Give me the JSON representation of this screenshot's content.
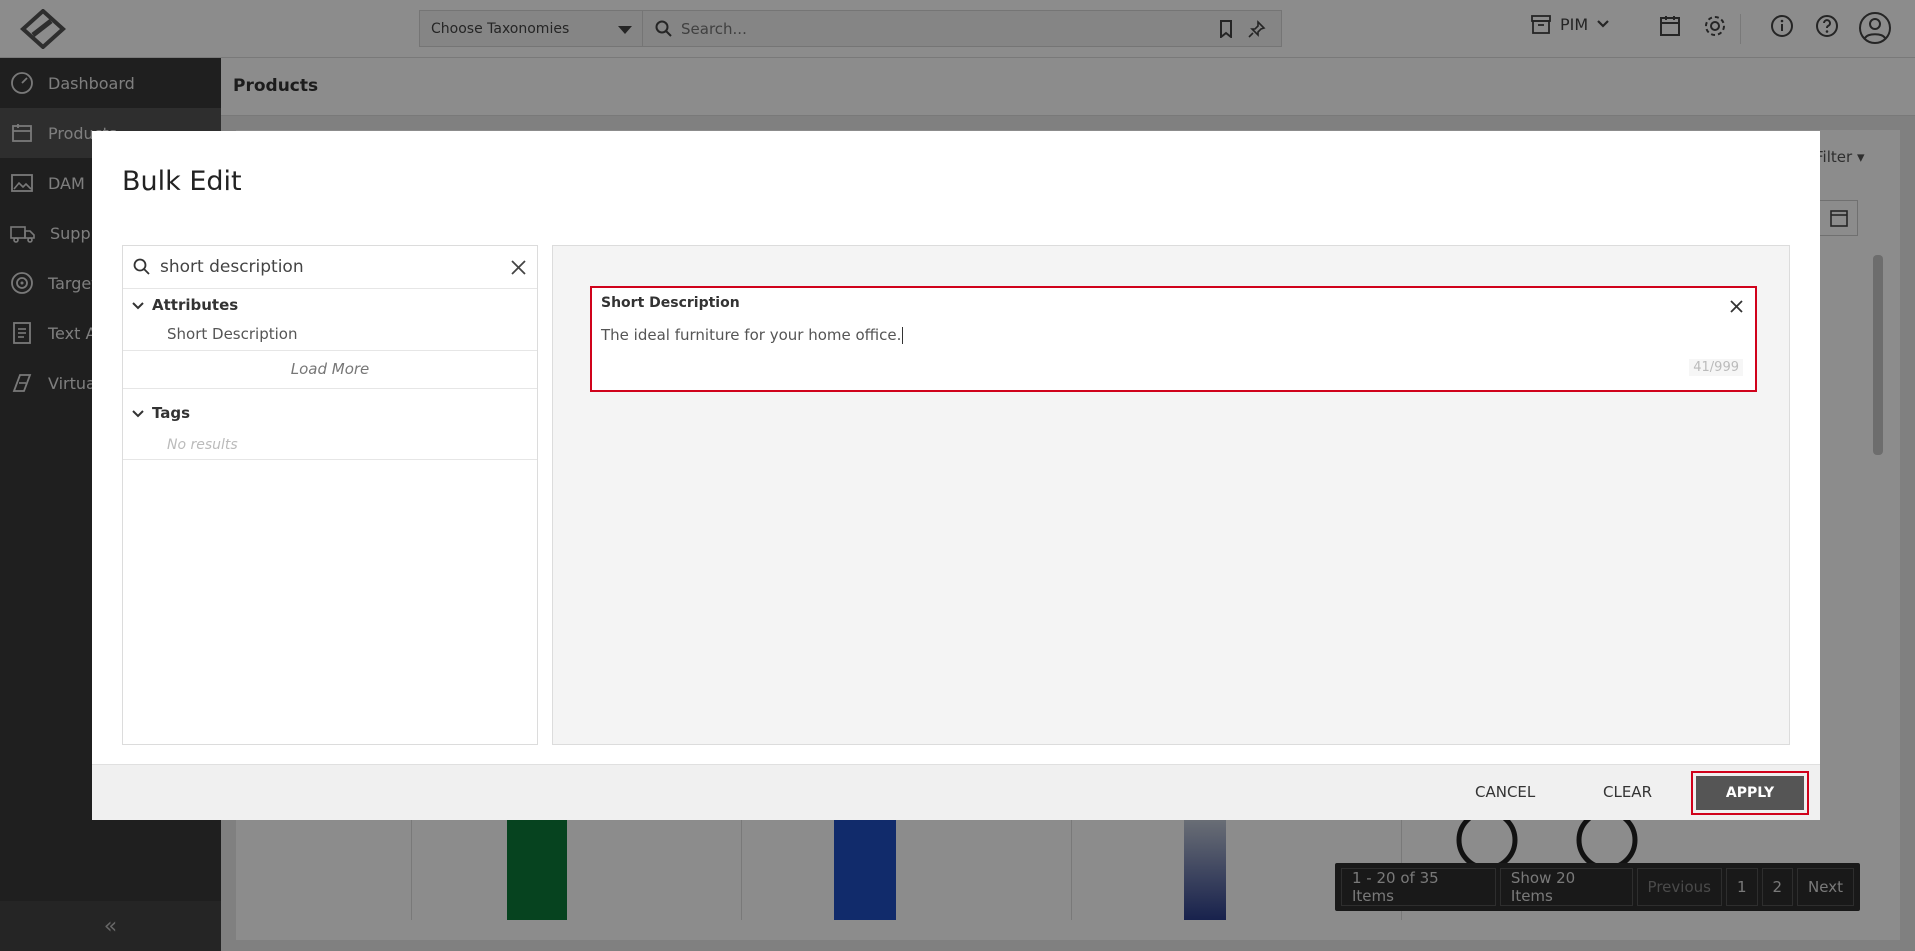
{
  "topbar": {
    "taxonomy_placeholder": "Choose Taxonomies",
    "search_placeholder": "Search...",
    "module_label": "PIM"
  },
  "sidebar": {
    "items": [
      {
        "label": "Dashboard",
        "icon": "dashboard-icon"
      },
      {
        "label": "Products",
        "icon": "products-icon"
      },
      {
        "label": "DAM",
        "icon": "image-icon"
      },
      {
        "label": "Suppliers",
        "icon": "truck-icon"
      },
      {
        "label": "Targets",
        "icon": "target-icon"
      },
      {
        "label": "Text Automation",
        "icon": "document-icon"
      },
      {
        "label": "Virtual",
        "icon": "virtual-icon"
      }
    ],
    "collapse_label": "«"
  },
  "main": {
    "title": "Products",
    "filter_label": "Filter",
    "pager": {
      "summary": "1 - 20 of 35 Items",
      "page_size": "Show 20 Items",
      "previous": "Previous",
      "pages": [
        "1",
        "2"
      ],
      "next": "Next"
    }
  },
  "modal": {
    "title": "Bulk Edit",
    "search_value": "short description",
    "groups": {
      "attributes_label": "Attributes",
      "attribute_items": [
        "Short Description"
      ],
      "load_more": "Load More",
      "tags_label": "Tags",
      "tags_empty": "No results"
    },
    "field": {
      "label": "Short Description",
      "value": "The ideal furniture for your home office.",
      "counter": "41/999"
    },
    "footer": {
      "cancel": "CANCEL",
      "clear": "CLEAR",
      "apply": "APPLY"
    }
  },
  "colors": {
    "highlight": "#d0021b",
    "sidebar_bg": "#3a3a3a",
    "apply_bg": "#555555"
  }
}
